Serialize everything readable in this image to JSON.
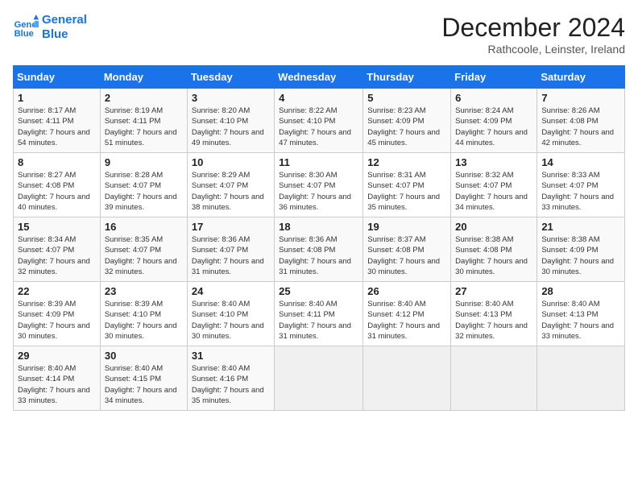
{
  "header": {
    "logo_line1": "General",
    "logo_line2": "Blue",
    "month": "December 2024",
    "location": "Rathcoole, Leinster, Ireland"
  },
  "days_of_week": [
    "Sunday",
    "Monday",
    "Tuesday",
    "Wednesday",
    "Thursday",
    "Friday",
    "Saturday"
  ],
  "weeks": [
    [
      {
        "num": "1",
        "sunrise": "8:17 AM",
        "sunset": "4:11 PM",
        "daylight": "7 hours and 54 minutes."
      },
      {
        "num": "2",
        "sunrise": "8:19 AM",
        "sunset": "4:11 PM",
        "daylight": "7 hours and 51 minutes."
      },
      {
        "num": "3",
        "sunrise": "8:20 AM",
        "sunset": "4:10 PM",
        "daylight": "7 hours and 49 minutes."
      },
      {
        "num": "4",
        "sunrise": "8:22 AM",
        "sunset": "4:10 PM",
        "daylight": "7 hours and 47 minutes."
      },
      {
        "num": "5",
        "sunrise": "8:23 AM",
        "sunset": "4:09 PM",
        "daylight": "7 hours and 45 minutes."
      },
      {
        "num": "6",
        "sunrise": "8:24 AM",
        "sunset": "4:09 PM",
        "daylight": "7 hours and 44 minutes."
      },
      {
        "num": "7",
        "sunrise": "8:26 AM",
        "sunset": "4:08 PM",
        "daylight": "7 hours and 42 minutes."
      }
    ],
    [
      {
        "num": "8",
        "sunrise": "8:27 AM",
        "sunset": "4:08 PM",
        "daylight": "7 hours and 40 minutes."
      },
      {
        "num": "9",
        "sunrise": "8:28 AM",
        "sunset": "4:07 PM",
        "daylight": "7 hours and 39 minutes."
      },
      {
        "num": "10",
        "sunrise": "8:29 AM",
        "sunset": "4:07 PM",
        "daylight": "7 hours and 38 minutes."
      },
      {
        "num": "11",
        "sunrise": "8:30 AM",
        "sunset": "4:07 PM",
        "daylight": "7 hours and 36 minutes."
      },
      {
        "num": "12",
        "sunrise": "8:31 AM",
        "sunset": "4:07 PM",
        "daylight": "7 hours and 35 minutes."
      },
      {
        "num": "13",
        "sunrise": "8:32 AM",
        "sunset": "4:07 PM",
        "daylight": "7 hours and 34 minutes."
      },
      {
        "num": "14",
        "sunrise": "8:33 AM",
        "sunset": "4:07 PM",
        "daylight": "7 hours and 33 minutes."
      }
    ],
    [
      {
        "num": "15",
        "sunrise": "8:34 AM",
        "sunset": "4:07 PM",
        "daylight": "7 hours and 32 minutes."
      },
      {
        "num": "16",
        "sunrise": "8:35 AM",
        "sunset": "4:07 PM",
        "daylight": "7 hours and 32 minutes."
      },
      {
        "num": "17",
        "sunrise": "8:36 AM",
        "sunset": "4:07 PM",
        "daylight": "7 hours and 31 minutes."
      },
      {
        "num": "18",
        "sunrise": "8:36 AM",
        "sunset": "4:08 PM",
        "daylight": "7 hours and 31 minutes."
      },
      {
        "num": "19",
        "sunrise": "8:37 AM",
        "sunset": "4:08 PM",
        "daylight": "7 hours and 30 minutes."
      },
      {
        "num": "20",
        "sunrise": "8:38 AM",
        "sunset": "4:08 PM",
        "daylight": "7 hours and 30 minutes."
      },
      {
        "num": "21",
        "sunrise": "8:38 AM",
        "sunset": "4:09 PM",
        "daylight": "7 hours and 30 minutes."
      }
    ],
    [
      {
        "num": "22",
        "sunrise": "8:39 AM",
        "sunset": "4:09 PM",
        "daylight": "7 hours and 30 minutes."
      },
      {
        "num": "23",
        "sunrise": "8:39 AM",
        "sunset": "4:10 PM",
        "daylight": "7 hours and 30 minutes."
      },
      {
        "num": "24",
        "sunrise": "8:40 AM",
        "sunset": "4:10 PM",
        "daylight": "7 hours and 30 minutes."
      },
      {
        "num": "25",
        "sunrise": "8:40 AM",
        "sunset": "4:11 PM",
        "daylight": "7 hours and 31 minutes."
      },
      {
        "num": "26",
        "sunrise": "8:40 AM",
        "sunset": "4:12 PM",
        "daylight": "7 hours and 31 minutes."
      },
      {
        "num": "27",
        "sunrise": "8:40 AM",
        "sunset": "4:13 PM",
        "daylight": "7 hours and 32 minutes."
      },
      {
        "num": "28",
        "sunrise": "8:40 AM",
        "sunset": "4:13 PM",
        "daylight": "7 hours and 33 minutes."
      }
    ],
    [
      {
        "num": "29",
        "sunrise": "8:40 AM",
        "sunset": "4:14 PM",
        "daylight": "7 hours and 33 minutes."
      },
      {
        "num": "30",
        "sunrise": "8:40 AM",
        "sunset": "4:15 PM",
        "daylight": "7 hours and 34 minutes."
      },
      {
        "num": "31",
        "sunrise": "8:40 AM",
        "sunset": "4:16 PM",
        "daylight": "7 hours and 35 minutes."
      },
      null,
      null,
      null,
      null
    ]
  ],
  "labels": {
    "sunrise": "Sunrise:",
    "sunset": "Sunset:",
    "daylight": "Daylight:"
  }
}
